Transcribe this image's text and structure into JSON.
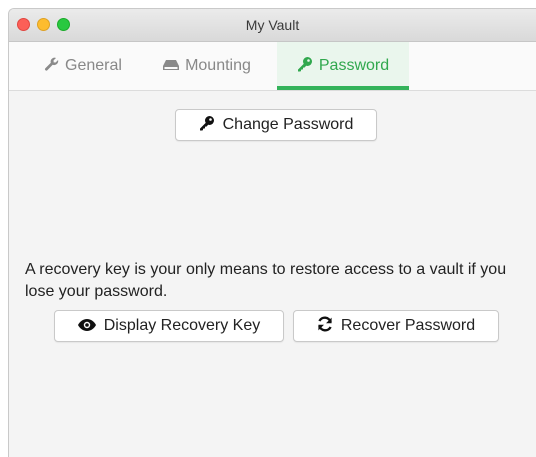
{
  "window": {
    "title": "My Vault",
    "controls": [
      "close",
      "minimize",
      "maximize"
    ]
  },
  "tabs": [
    {
      "label": "General",
      "icon": "wrench-icon",
      "active": false
    },
    {
      "label": "Mounting",
      "icon": "drive-icon",
      "active": false
    },
    {
      "label": "Password",
      "icon": "key-icon",
      "active": true
    }
  ],
  "password_pane": {
    "change_password_label": "Change Password",
    "recovery_text": "A recovery key is your only means to restore access to a vault if you lose your password.",
    "display_recovery_key_label": "Display Recovery Key",
    "recover_password_label": "Recover Password"
  },
  "colors": {
    "accent": "#31a84e",
    "active_tab_bg": "#eaf6ed",
    "close": "#fc5f57",
    "minimize": "#fdbc2e",
    "maximize": "#29c840"
  }
}
